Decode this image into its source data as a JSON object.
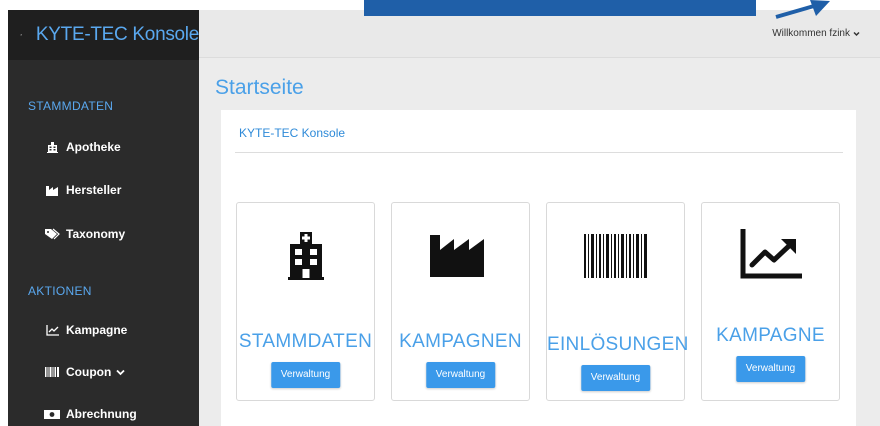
{
  "app": {
    "brand_title": "KYTE-TEC Konsole",
    "brand_icon": "logo-icon"
  },
  "sidebar": {
    "sections": [
      {
        "title": "STAMMDATEN",
        "items": [
          {
            "label": "Apotheke",
            "icon": "building-icon"
          },
          {
            "label": "Hersteller",
            "icon": "factory-icon"
          },
          {
            "label": "Taxonomy",
            "icon": "tags-icon"
          }
        ]
      },
      {
        "title": "AKTIONEN",
        "items": [
          {
            "label": "Kampagne",
            "icon": "chart-line-icon"
          },
          {
            "label": "Coupon",
            "icon": "barcode-icon",
            "has_dropdown": true
          },
          {
            "label": "Abrechnung",
            "icon": "money-icon"
          }
        ]
      }
    ]
  },
  "topbar": {
    "welcome_text": "Willkommen fzink"
  },
  "main": {
    "page_title": "Startseite",
    "panel_title": "KYTE-TEC Konsole",
    "cards": [
      {
        "label": "STAMMDATEN",
        "icon": "building-icon",
        "button": "Verwaltung"
      },
      {
        "label": "KAMPAGNEN",
        "icon": "factory-icon",
        "button": "Verwaltung"
      },
      {
        "label": "EINLÖSUNGEN",
        "icon": "barcode-icon",
        "button": "Verwaltung"
      },
      {
        "label": "KAMPAGNE",
        "icon": "chart-line-icon",
        "button": "Verwaltung"
      }
    ]
  },
  "colors": {
    "accent": "#4aa0e8",
    "button": "#3a99ea",
    "sidebar_bg": "#2b2b2b",
    "callout": "#1f5fa8"
  }
}
